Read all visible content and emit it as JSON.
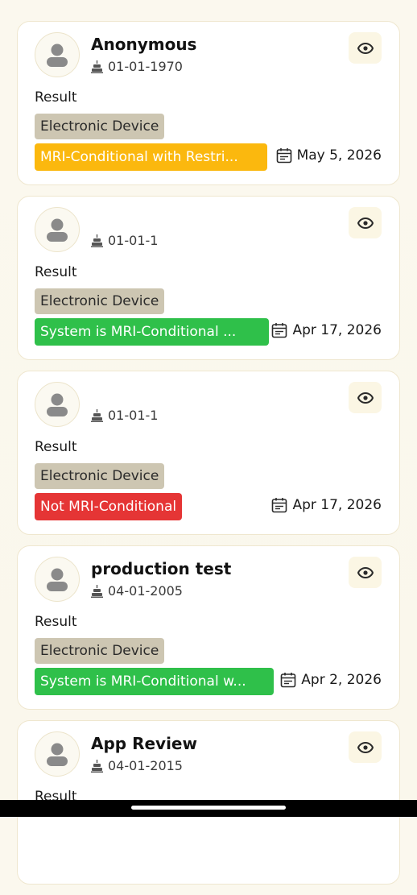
{
  "icons": {
    "avatar": "person-icon",
    "dob": "cake-icon",
    "view": "eye-icon",
    "date": "calendar-icon"
  },
  "colors": {
    "background": "#fbf8ee",
    "device_chip": "#cdc6b2",
    "status_yellow": "#fbb80e",
    "status_green": "#2fc04a",
    "status_red": "#e53535"
  },
  "cards": [
    {
      "name": "Anonymous",
      "dob": "01-01-1970",
      "result_label": "Result",
      "device": "Electronic Device",
      "status": "MRI-Conditional with Restri...",
      "status_color": "#fbb80e",
      "date": "May 5, 2026"
    },
    {
      "name": "",
      "dob": "01-01-1",
      "result_label": "Result",
      "device": "Electronic Device",
      "status": "System is MRI-Conditional ...",
      "status_color": "#2fc04a",
      "date": "Apr 17, 2026"
    },
    {
      "name": "",
      "dob": "01-01-1",
      "result_label": "Result",
      "device": "Electronic Device",
      "status": "Not MRI-Conditional",
      "status_color": "#e53535",
      "date": "Apr 17, 2026"
    },
    {
      "name": "production test",
      "dob": "04-01-2005",
      "result_label": "Result",
      "device": "Electronic Device",
      "status": "System is MRI-Conditional w...",
      "status_color": "#2fc04a",
      "date": "Apr 2, 2026"
    },
    {
      "name": "App Review",
      "dob": "04-01-2015",
      "result_label": "Result",
      "device": "",
      "status": "",
      "status_color": "",
      "date": ""
    }
  ]
}
